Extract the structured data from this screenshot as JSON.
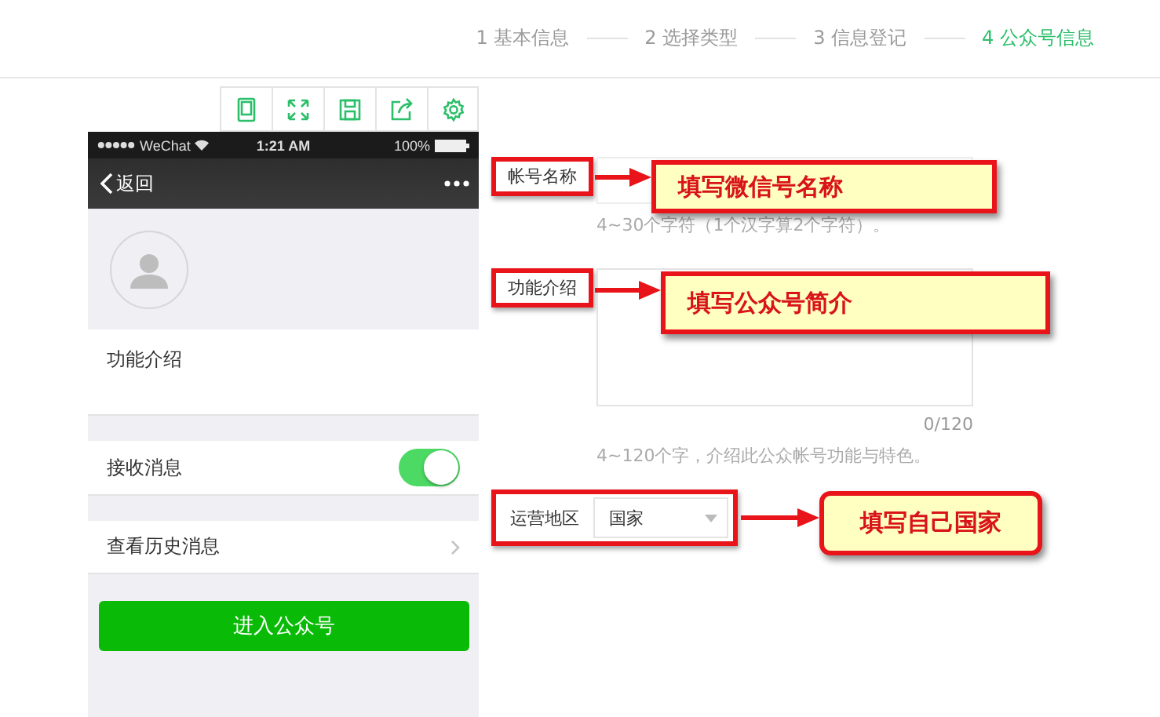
{
  "steps": [
    {
      "label": "1 基本信息",
      "selected": false
    },
    {
      "label": "2 选择类型",
      "selected": false
    },
    {
      "label": "3 信息登记",
      "selected": false
    },
    {
      "label": "4 公众号信息",
      "selected": true
    }
  ],
  "phone": {
    "status": {
      "carrier": "WeChat",
      "time": "1:21 AM",
      "battery": "100%"
    },
    "nav": {
      "back": "返回"
    },
    "rows": [
      {
        "kind": "text",
        "label": "功能介绍"
      },
      {
        "kind": "toggle",
        "label": "接收消息",
        "on": true
      },
      {
        "kind": "link",
        "label": "查看历史消息"
      }
    ],
    "button": "进入公众号"
  },
  "form": {
    "fields": [
      {
        "kind": "input",
        "label": "帐号名称",
        "hint": "4~30个字符（1个汉字算2个字符）。",
        "annotation": "填写微信号名称"
      },
      {
        "kind": "textarea",
        "label": "功能介绍",
        "counter": "0/120",
        "hint": "4~120个字，介绍此公众帐号功能与特色。",
        "annotation": "填写公众号简介"
      },
      {
        "kind": "select",
        "label": "运营地区",
        "value": "国家",
        "annotation": "填写自己国家"
      }
    ]
  }
}
